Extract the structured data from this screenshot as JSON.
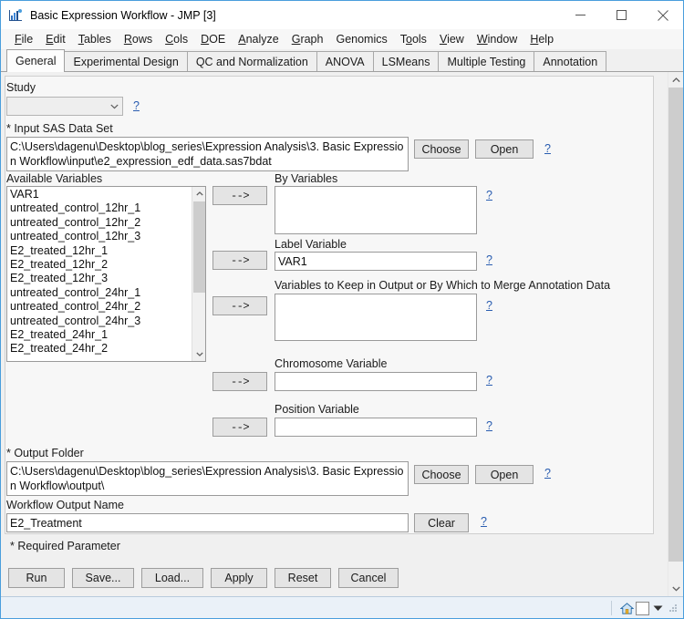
{
  "window": {
    "title": "Basic Expression Workflow - JMP [3]",
    "icon": "jmp-app-icon",
    "controls": {
      "minimize": "minimize-icon",
      "maximize": "maximize-icon",
      "close": "close-icon"
    }
  },
  "menubar": {
    "items": [
      {
        "label": "File",
        "accel": "F"
      },
      {
        "label": "Edit",
        "accel": "E"
      },
      {
        "label": "Tables",
        "accel": "T"
      },
      {
        "label": "Rows",
        "accel": "R"
      },
      {
        "label": "Cols",
        "accel": "C"
      },
      {
        "label": "DOE",
        "accel": "D"
      },
      {
        "label": "Analyze",
        "accel": "A"
      },
      {
        "label": "Graph",
        "accel": "G"
      },
      {
        "label": "Genomics",
        "accel": ""
      },
      {
        "label": "Tools",
        "accel": "o"
      },
      {
        "label": "View",
        "accel": "V"
      },
      {
        "label": "Window",
        "accel": "W"
      },
      {
        "label": "Help",
        "accel": "H"
      }
    ]
  },
  "tabs": {
    "active": "General",
    "items": [
      {
        "label": "General"
      },
      {
        "label": "Experimental Design"
      },
      {
        "label": "QC and Normalization"
      },
      {
        "label": "ANOVA"
      },
      {
        "label": "LSMeans"
      },
      {
        "label": "Multiple Testing"
      },
      {
        "label": "Annotation"
      }
    ]
  },
  "form": {
    "study": {
      "label": "Study",
      "value": "",
      "help": "?"
    },
    "input_data_set": {
      "label": "* Input SAS Data Set",
      "value": "C:\\Users\\dagenu\\Desktop\\blog_series\\Expression Analysis\\3. Basic Expression Workflow\\input\\e2_expression_edf_data.sas7bdat",
      "choose_label": "Choose",
      "open_label": "Open",
      "help": "?"
    },
    "available_variables": {
      "label": "Available Variables",
      "items": [
        "VAR1",
        "untreated_control_12hr_1",
        "untreated_control_12hr_2",
        "untreated_control_12hr_3",
        "E2_treated_12hr_1",
        "E2_treated_12hr_2",
        "E2_treated_12hr_3",
        "untreated_control_24hr_1",
        "untreated_control_24hr_2",
        "untreated_control_24hr_3",
        "E2_treated_24hr_1",
        "E2_treated_24hr_2"
      ]
    },
    "transfer_buttons": {
      "by_variables": "-->",
      "label_variable": "-->",
      "keep_variables": "-->",
      "chromosome_variable": "-->",
      "position_variable": "-->"
    },
    "by_variables": {
      "label": "By Variables",
      "value": "",
      "help": "?"
    },
    "label_variable": {
      "label": "Label Variable",
      "value": "VAR1",
      "help": "?"
    },
    "keep_variables": {
      "label": "Variables to Keep in Output or By Which to Merge Annotation Data",
      "value": "",
      "help": "?"
    },
    "chromosome_variable": {
      "label": "Chromosome Variable",
      "value": "",
      "help": "?"
    },
    "position_variable": {
      "label": "Position Variable",
      "value": "",
      "help": "?"
    },
    "output_folder": {
      "label": "* Output Folder",
      "value": "C:\\Users\\dagenu\\Desktop\\blog_series\\Expression Analysis\\3. Basic Expression Workflow\\output\\",
      "choose_label": "Choose",
      "open_label": "Open",
      "help": "?"
    },
    "workflow_output_name": {
      "label": "Workflow Output Name",
      "value": "E2_Treatment",
      "clear_label": "Clear",
      "help": "?"
    },
    "required_note": "* Required Parameter"
  },
  "actions": [
    {
      "label": "Run"
    },
    {
      "label": "Save..."
    },
    {
      "label": "Load..."
    },
    {
      "label": "Apply"
    },
    {
      "label": "Reset"
    },
    {
      "label": "Cancel"
    }
  ],
  "statusbar": {
    "home_icon": "home-icon",
    "swatch": "color-swatch",
    "dropdown": "chevron-down-icon"
  },
  "colors": {
    "window_border": "#4a9edd",
    "panel_bg": "#f7f7f7",
    "link": "#2a5db0",
    "statusbar_bg": "#eaf1f8"
  }
}
